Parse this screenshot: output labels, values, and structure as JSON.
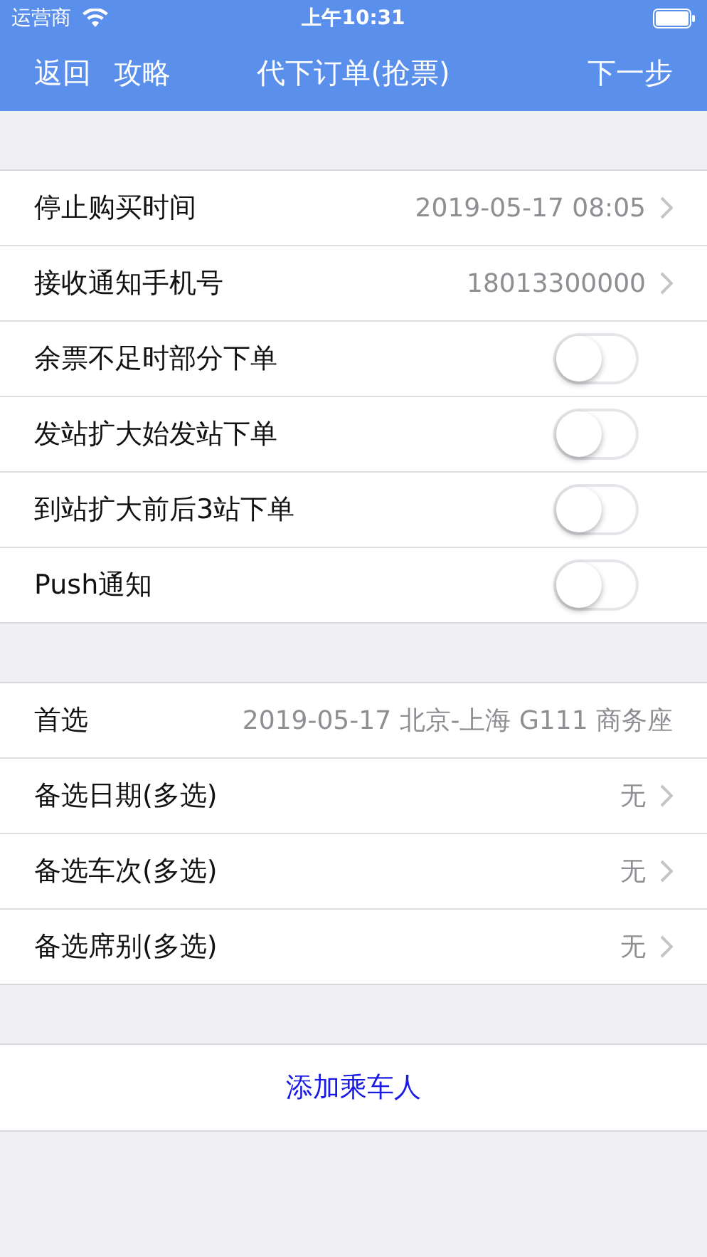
{
  "status_bar": {
    "carrier": "运营商",
    "time": "上午10:31"
  },
  "nav": {
    "left": [
      "返回",
      "攻略"
    ],
    "title": "代下订单(抢票)",
    "right": "下一步"
  },
  "sections": [
    {
      "rows": [
        {
          "kind": "link",
          "label": "停止购买时间",
          "value": "2019-05-17 08:05"
        },
        {
          "kind": "link",
          "label": "接收通知手机号",
          "value": "18013300000"
        },
        {
          "kind": "toggle",
          "label": "余票不足时部分下单",
          "on": false
        },
        {
          "kind": "toggle",
          "label": "发站扩大始发站下单",
          "on": false
        },
        {
          "kind": "toggle",
          "label": "到站扩大前后3站下单",
          "on": false
        },
        {
          "kind": "toggle",
          "label": "Push通知",
          "on": false
        }
      ]
    },
    {
      "rows": [
        {
          "kind": "text",
          "label": "首选",
          "value": "2019-05-17 北京-上海 G111 商务座"
        },
        {
          "kind": "link",
          "label": "备选日期(多选)",
          "value": "无"
        },
        {
          "kind": "link",
          "label": "备选车次(多选)",
          "value": "无"
        },
        {
          "kind": "link",
          "label": "备选席别(多选)",
          "value": "无"
        }
      ]
    }
  ],
  "action": "添加乘车人"
}
